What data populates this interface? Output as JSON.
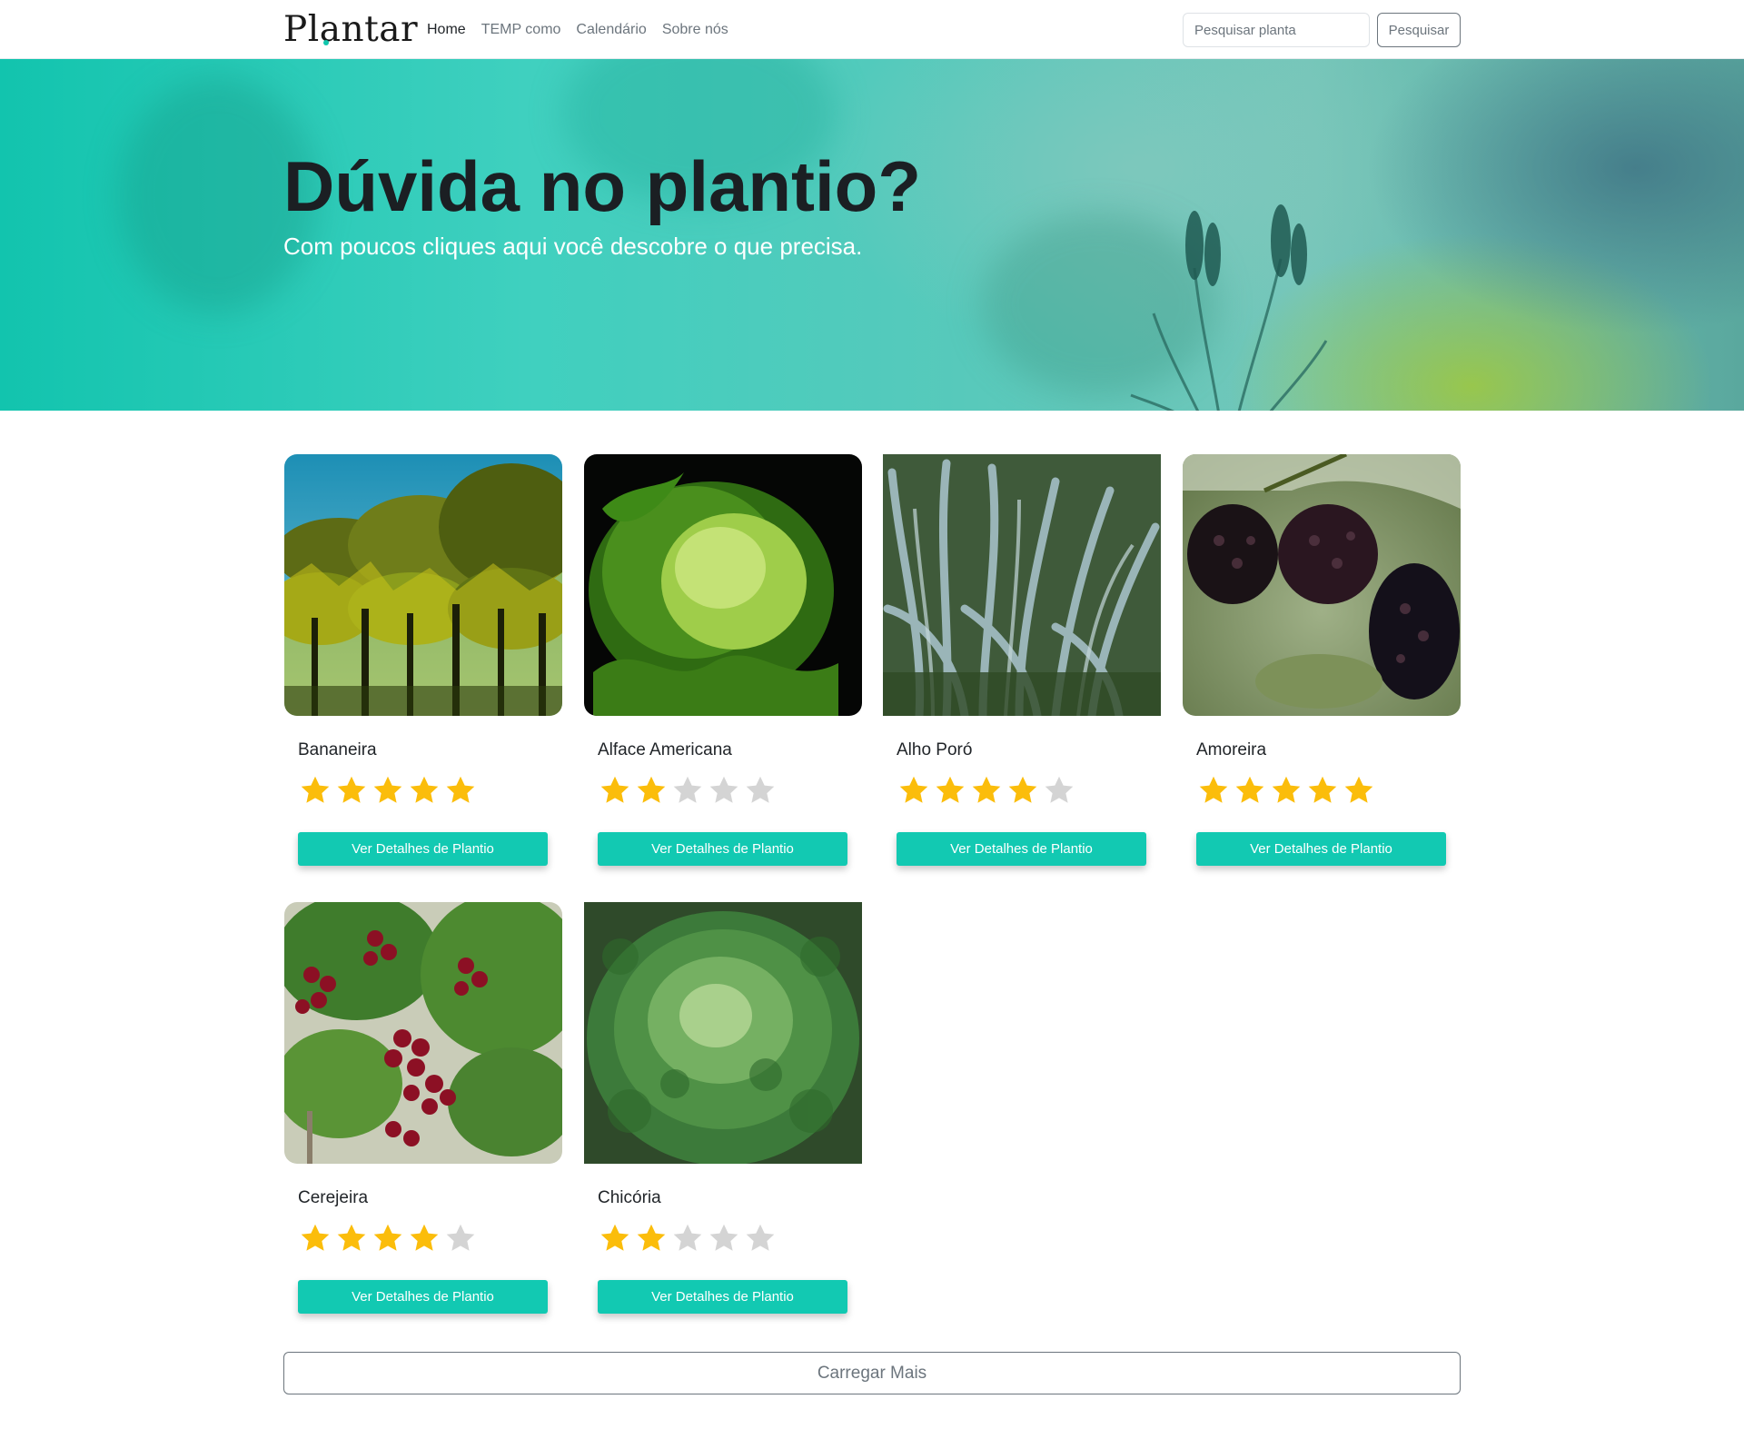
{
  "navbar": {
    "brand": "Plantar",
    "links": [
      {
        "label": "Home",
        "active": true
      },
      {
        "label": "TEMP como",
        "active": false
      },
      {
        "label": "Calendário",
        "active": false
      },
      {
        "label": "Sobre nós",
        "active": false
      }
    ],
    "search_placeholder": "Pesquisar planta",
    "search_button": "Pesquisar"
  },
  "hero": {
    "title": "Dúvida no plantio?",
    "subtitle": "Com poucos cliques aqui você descobre o que precisa."
  },
  "plants": [
    {
      "name": "Bananeira",
      "rating": 5,
      "max_rating": 5,
      "button": "Ver Detalhes de Plantio",
      "image": "banana-trees-photo"
    },
    {
      "name": "Alface Americana",
      "rating": 2,
      "max_rating": 5,
      "button": "Ver Detalhes de Plantio",
      "image": "iceberg-lettuce-photo"
    },
    {
      "name": "Alho Poró",
      "rating": 4,
      "max_rating": 5,
      "button": "Ver Detalhes de Plantio",
      "image": "leek-photo"
    },
    {
      "name": "Amoreira",
      "rating": 5,
      "max_rating": 5,
      "button": "Ver Detalhes de Plantio",
      "image": "blackberries-photo"
    },
    {
      "name": "Cerejeira",
      "rating": 4,
      "max_rating": 5,
      "button": "Ver Detalhes de Plantio",
      "image": "cherries-photo"
    },
    {
      "name": "Chicória",
      "rating": 2,
      "max_rating": 5,
      "button": "Ver Detalhes de Plantio",
      "image": "chicory-photo"
    }
  ],
  "load_more": "Carregar Mais",
  "colors": {
    "accent": "#12c9b2",
    "star_filled": "#fbbd0b",
    "star_empty": "#d4d4d4"
  }
}
